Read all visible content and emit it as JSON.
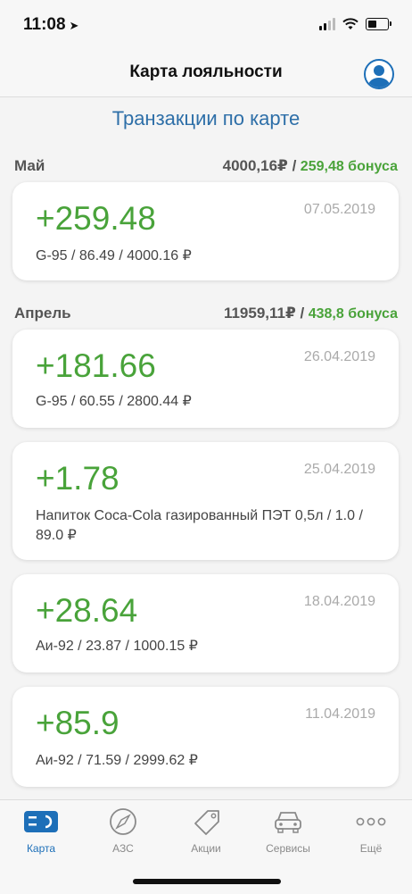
{
  "status": {
    "time": "11:08"
  },
  "header": {
    "title": "Карта лояльности"
  },
  "section": {
    "title": "Транзакции по карте"
  },
  "months": [
    {
      "name": "Май",
      "sum": "4000,16₽ /",
      "bonus": "259,48 бонуса"
    },
    {
      "name": "Апрель",
      "sum": "11959,11₽ /",
      "bonus": "438,8 бонуса"
    }
  ],
  "transactions": [
    {
      "amount": "+259.48",
      "date": "07.05.2019",
      "detail": "G-95 / 86.49 / 4000.16 ₽"
    },
    {
      "amount": "+181.66",
      "date": "26.04.2019",
      "detail": "G-95 / 60.55 / 2800.44 ₽"
    },
    {
      "amount": "+1.78",
      "date": "25.04.2019",
      "detail": "Напиток Coca-Cola газированный ПЭТ 0,5л / 1.0 / 89.0 ₽"
    },
    {
      "amount": "+28.64",
      "date": "18.04.2019",
      "detail": "Аи-92 / 23.87 / 1000.15 ₽"
    },
    {
      "amount": "+85.9",
      "date": "11.04.2019",
      "detail": "Аи-92 / 71.59 / 2999.62 ₽"
    }
  ],
  "tabs": [
    {
      "label": "Карта",
      "icon": "card-icon",
      "active": true
    },
    {
      "label": "АЗС",
      "icon": "compass-icon"
    },
    {
      "label": "Акции",
      "icon": "tag-icon"
    },
    {
      "label": "Сервисы",
      "icon": "car-icon"
    },
    {
      "label": "Ещё",
      "icon": "more-icon"
    }
  ],
  "colors": {
    "accent": "#1d6fb8",
    "positive": "#49a33a",
    "section_title": "#2e6fa8"
  }
}
